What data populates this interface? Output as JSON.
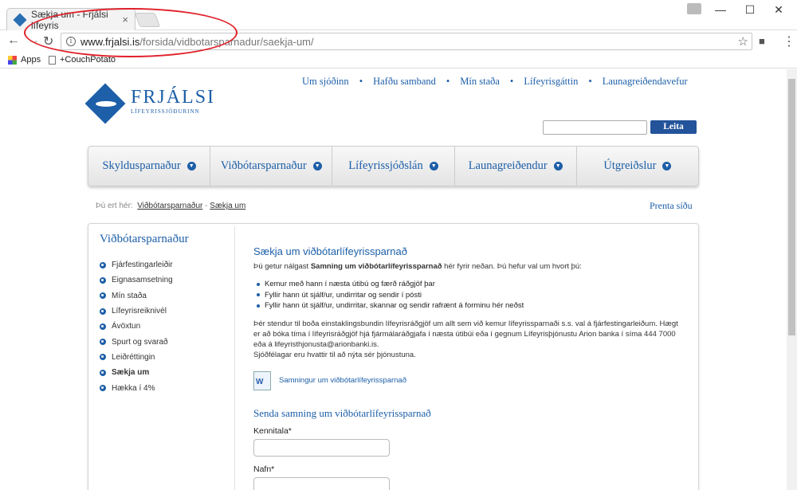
{
  "browser": {
    "tab_title": "Sækja um - Frjálsi lífeyris",
    "tab_close": "×",
    "url_host": "www.frjalsi.is",
    "url_path": "/forsida/vidbotarsparnadur/saekja-um/",
    "bookmarks": [
      {
        "label": "Apps",
        "icon": "apps-grid-icon"
      },
      {
        "label": "+CouchPotato",
        "icon": "page-icon"
      }
    ],
    "window_controls": {
      "minimize": "—",
      "maximize": "☐",
      "close": "✕"
    }
  },
  "top_links": [
    "Um sjóðinn",
    "Hafðu samband",
    "Mín staða",
    "Lífeyrisgáttin",
    "Launagreiðendavefur"
  ],
  "logo": {
    "name": "FRJÁLSI",
    "sub": "LÍFEYRISSJÓÐURINN"
  },
  "search": {
    "button": "Leita",
    "value": ""
  },
  "main_nav": [
    "Skyldusparnaður",
    "Viðbótarsparnaður",
    "Lífeyrissjóðslán",
    "Launagreiðendur",
    "Útgreiðslur"
  ],
  "breadcrumb": {
    "prefix": "Þú ert hér:",
    "items": [
      "Viðbótarsparnaður",
      "Sækja um"
    ],
    "sep": "-"
  },
  "print_link": "Prenta síðu",
  "sidebar": {
    "title": "Viðbótarsparnaður",
    "items": [
      "Fjárfestingarleiðir",
      "Eignasamsetning",
      "Mín staða",
      "Lífeyrisreiknivél",
      "Ávöxtun",
      "Spurt og svarað",
      "Leiðréttingin",
      "Sækja um",
      "Hækka í 4%"
    ],
    "active": 7
  },
  "content": {
    "title": "Sækja um viðbótarlífeyrissparnað",
    "intro_a": "Þú getur nálgast ",
    "intro_bold": "Samning um viðbótarlífeyrissparnað",
    "intro_b": " hér fyrir neðan. Þú hefur val um hvort þú:",
    "bullets": [
      "Kemur með hann í næsta útibú og færð ráðgjöf þar",
      "Fyllir hann út sjálf/ur, undirritar og sendir í pósti",
      "Fyllir hann út sjálf/ur, undirritar, skannar og sendir rafrænt á forminu hér neðst"
    ],
    "para1": "Þér stendur til boða einstaklingsbundin lífeyrisráðgjöf um allt sem við kemur lífeyrissparnaði s.s. val á fjárfestingarleiðum. Hægt er að bóka tíma í lífeyrisráðgjöf hjá fjármálaráðgjafa í næsta útibúi eða í gegnum Lífeyrisþjónustu Arion banka í síma 444 7000 eða á lifeyristhjonusta@arionbanki.is.",
    "para2": "Sjóðfélagar eru hvattir til að nýta sér þjónustuna.",
    "doc_link": "Samningur um viðbótarlífeyrissparnað",
    "form_title": "Senda samning um viðbótarlífeyrissparnað",
    "field1_label": "Kennitala*",
    "field2_label": "Nafn*"
  },
  "colors": {
    "brand": "#1d5fa8",
    "annotation": "#e0202a"
  }
}
